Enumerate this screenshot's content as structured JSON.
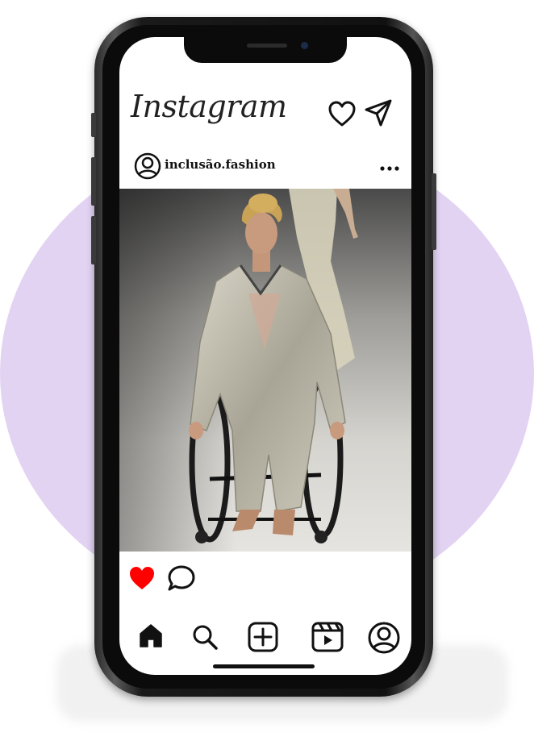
{
  "app": {
    "logo_text": "Instagram"
  },
  "header_icons": [
    "heart-icon",
    "send-icon"
  ],
  "post": {
    "username": "inclusão.fashion",
    "menu_icon": "more-icon",
    "image_description_icon": "runway-photo"
  },
  "actions": {
    "like_color": "#ff0000",
    "icons": [
      "heart-filled-icon",
      "comment-icon"
    ]
  },
  "bottom_nav": {
    "icons": [
      "home-icon",
      "search-icon",
      "add-post-icon",
      "reels-icon",
      "profile-icon"
    ]
  },
  "colors": {
    "background_circle": "#e3d3f3",
    "like": "#ff0000"
  }
}
